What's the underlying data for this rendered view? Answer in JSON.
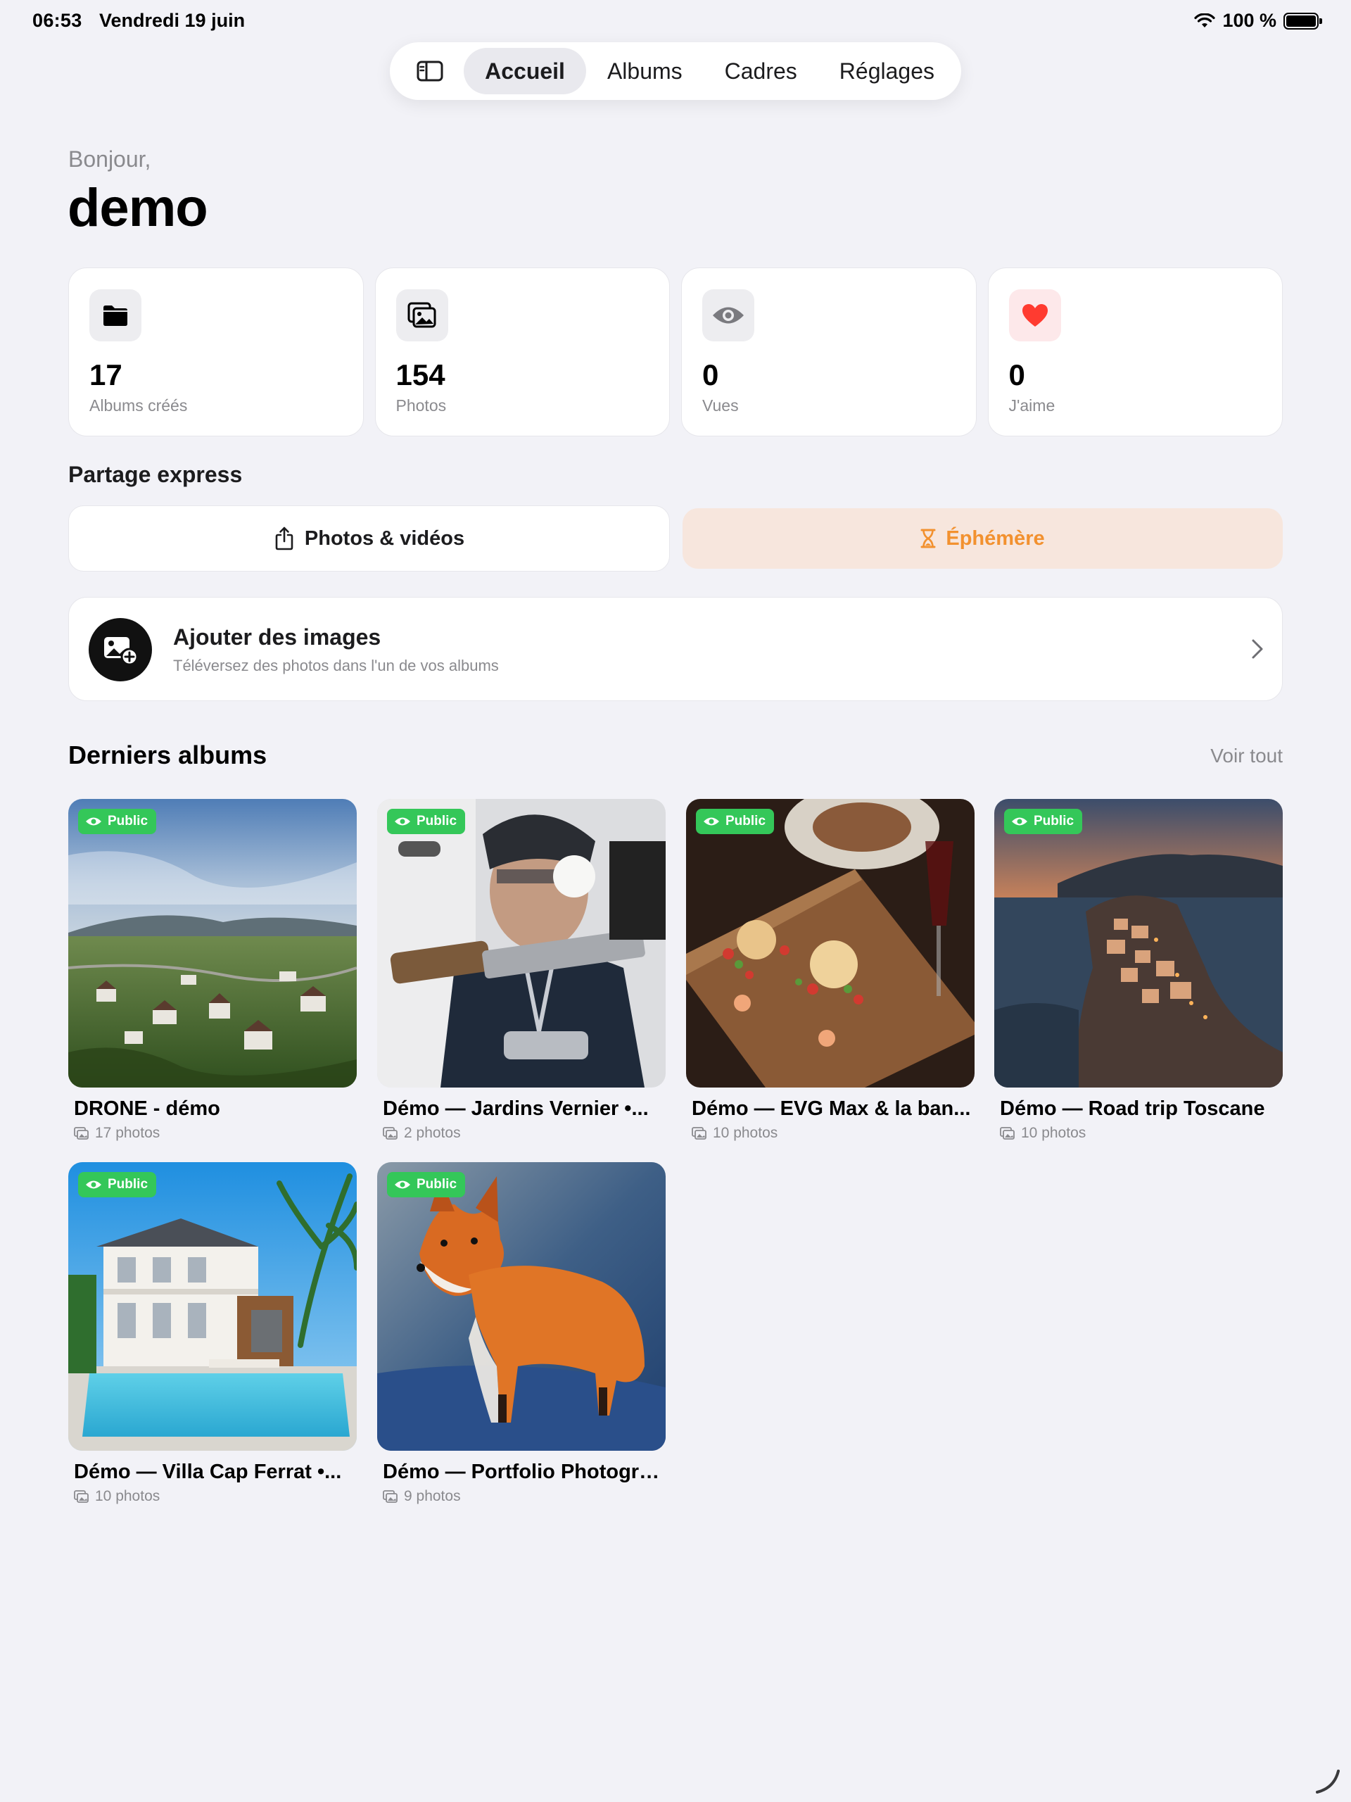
{
  "status": {
    "time": "06:53",
    "date": "Vendredi 19 juin",
    "battery": "100 %"
  },
  "nav": {
    "tabs": [
      {
        "label": "Accueil",
        "active": true
      },
      {
        "label": "Albums"
      },
      {
        "label": "Cadres"
      },
      {
        "label": "Réglages"
      }
    ]
  },
  "greeting": "Bonjour,",
  "username": "demo",
  "stats": [
    {
      "icon": "folder-icon",
      "value": "17",
      "label": "Albums créés"
    },
    {
      "icon": "photos-icon",
      "value": "154",
      "label": "Photos"
    },
    {
      "icon": "eye-icon",
      "value": "0",
      "label": "Vues"
    },
    {
      "icon": "heart-icon",
      "value": "0",
      "label": "J'aime",
      "color": "#ff3b30"
    }
  ],
  "quick_share": {
    "title": "Partage express",
    "photos_label": "Photos & vidéos",
    "ephemeral_label": "Éphémère",
    "ephemeral_color": "#f2912f"
  },
  "add_images": {
    "title": "Ajouter des images",
    "subtitle": "Téléversez des photos dans l'un de vos albums"
  },
  "recent_albums": {
    "title": "Derniers albums",
    "see_all": "Voir tout",
    "badge_label": "Public",
    "badge_color": "#34c759",
    "items": [
      {
        "name": "DRONE - démo",
        "count": "17 photos"
      },
      {
        "name": "Démo — Jardins Vernier •...",
        "count": "2 photos"
      },
      {
        "name": "Démo — EVG Max & la ban...",
        "count": "10 photos"
      },
      {
        "name": "Démo — Road trip Toscane",
        "count": "10 photos"
      },
      {
        "name": "Démo — Villa Cap Ferrat •...",
        "count": "10 photos"
      },
      {
        "name": "Démo — Portfolio Photogra...",
        "count": "9 photos"
      }
    ]
  }
}
